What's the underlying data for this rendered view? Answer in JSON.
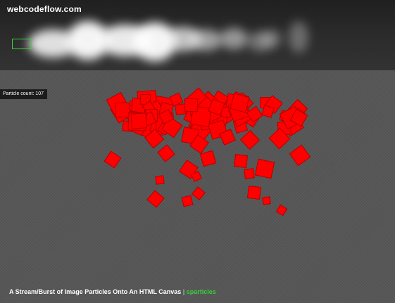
{
  "header": {
    "site_title": "webcodeflow.com"
  },
  "counter": {
    "text": "Particle count: 107"
  },
  "caption": {
    "text": "A Stream/Burst of Image Particles Onto An HTML Canvas",
    "separator": " | ",
    "link": "sparticles"
  },
  "colors": {
    "particle": "#ff0000",
    "highlight_box": "#3fd13f",
    "link": "#3ccd3c"
  }
}
